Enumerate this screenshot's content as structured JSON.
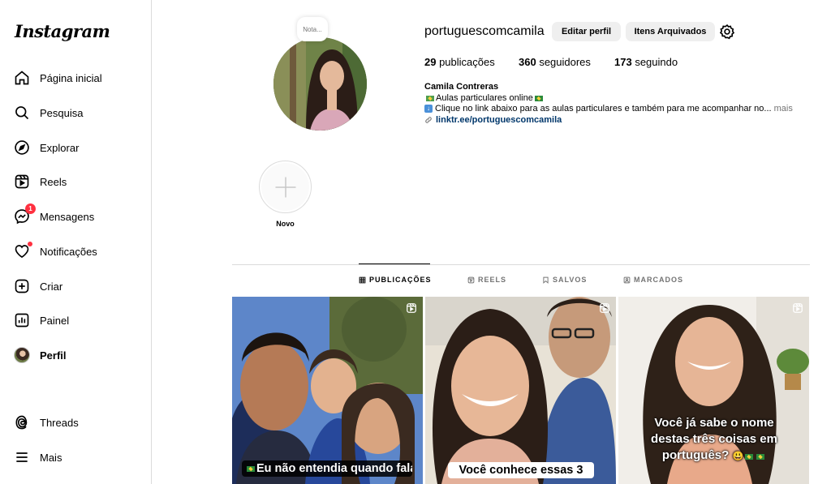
{
  "app": {
    "logo": "Instagram"
  },
  "sidebar": {
    "items": [
      {
        "label": "Página inicial",
        "icon": "home-icon"
      },
      {
        "label": "Pesquisa",
        "icon": "search-icon"
      },
      {
        "label": "Explorar",
        "icon": "compass-icon"
      },
      {
        "label": "Reels",
        "icon": "reels-icon"
      },
      {
        "label": "Mensagens",
        "icon": "messenger-icon",
        "badge": "1"
      },
      {
        "label": "Notificações",
        "icon": "heart-icon"
      },
      {
        "label": "Criar",
        "icon": "plus-square-icon"
      },
      {
        "label": "Painel",
        "icon": "chart-icon"
      },
      {
        "label": "Perfil",
        "icon": "avatar"
      },
      {
        "label": "Threads",
        "icon": "threads-icon"
      },
      {
        "label": "Mais",
        "icon": "menu-icon"
      }
    ]
  },
  "profile": {
    "note": "Nota...",
    "username": "portuguescomcamila",
    "edit_button": "Editar perfil",
    "archive_button": "Itens Arquivados",
    "stats": {
      "posts_count": "29",
      "posts_label": " publicações",
      "followers_count": "360",
      "followers_label": " seguidores",
      "following_count": "173",
      "following_label": " seguindo"
    },
    "full_name": "Camila Contreras",
    "bio_line1": "Aulas particulares online",
    "bio_line2": "Clique no link abaixo para as aulas particulares e também para me acompanhar no...",
    "more": " mais",
    "link": "linktr.ee/portuguescomcamila"
  },
  "highlights": {
    "new_label": "Novo"
  },
  "tabs": [
    {
      "label": "PUBLICAÇÕES",
      "icon": "grid-icon"
    },
    {
      "label": "REELS",
      "icon": "reels-icon"
    },
    {
      "label": "SALVOS",
      "icon": "bookmark-icon"
    },
    {
      "label": "MARCADOS",
      "icon": "tagged-icon"
    }
  ],
  "posts": [
    {
      "caption": "Eu não entendia quando falavam"
    },
    {
      "caption": "Você conhece essas 3"
    },
    {
      "caption": "Você já sabe o nome destas três coisas em português?"
    }
  ],
  "colors": {
    "badge": "#ff3040",
    "link": "#00376b",
    "button_bg": "#efefef",
    "border": "#dbdbdb"
  }
}
